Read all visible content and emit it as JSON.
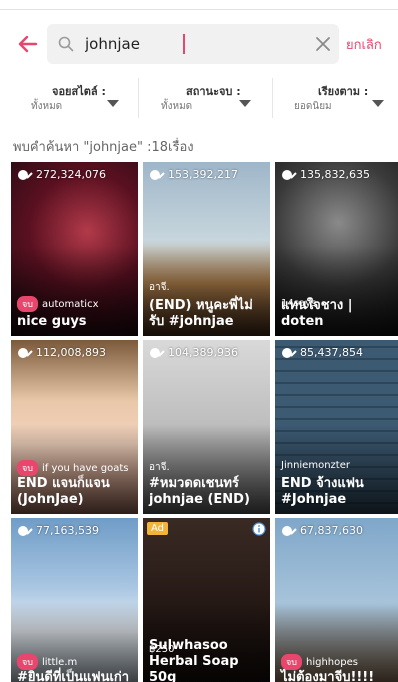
{
  "search": {
    "query": "johnjae",
    "cancel_label": "ยกเลิก"
  },
  "filters": [
    {
      "label": "จอยสไตล์ :",
      "value": "ทั้งหมด"
    },
    {
      "label": "สถานะจบ :",
      "value": "ทั้งหมด"
    },
    {
      "label": "เรียงตาม :",
      "value": "ยอดนิยม"
    }
  ],
  "results": {
    "summary": "พบคำค้นหา \"johnjae\" :18เรื่อง"
  },
  "cards": [
    {
      "views": "272,324,076",
      "badge": "จบ",
      "author": "automaticx",
      "title": "nice guys"
    },
    {
      "views": "153,392,217",
      "badge": "",
      "author": "อาจี.",
      "title": "(END) หนูคะพี่ไม่รับ #johnjae"
    },
    {
      "views": "135,832,635",
      "badge": "",
      "author": "14says",
      "title": "แทนใจชาง | doten"
    },
    {
      "views": "112,008,893",
      "badge": "จบ",
      "author": "if you have goats",
      "title": "END แจนก็แจน (JohnJae)"
    },
    {
      "views": "104,389,936",
      "badge": "",
      "author": "อาจี.",
      "title": "#หมวดดเชนทร์ johnjae (END)"
    },
    {
      "views": "85,437,854",
      "badge": "",
      "author": "Jinniemonzter",
      "title": "END จ้างแฟน #Johnjae"
    },
    {
      "views": "77,163,539",
      "badge": "จบ",
      "author": "little.m",
      "title": "#ยินดีที่เป็นแฟนเก่า"
    },
    {
      "ad": "Ad",
      "price": "฿250",
      "title": "Sulwhasoo Herbal Soap 50g"
    },
    {
      "views": "67,837,630",
      "badge": "จบ",
      "author": "highhopes",
      "title": "ไม่ต้องมาจีบ!!!!"
    }
  ],
  "colors": {
    "accent": "#e8466d",
    "ad": "#f2b53a"
  }
}
